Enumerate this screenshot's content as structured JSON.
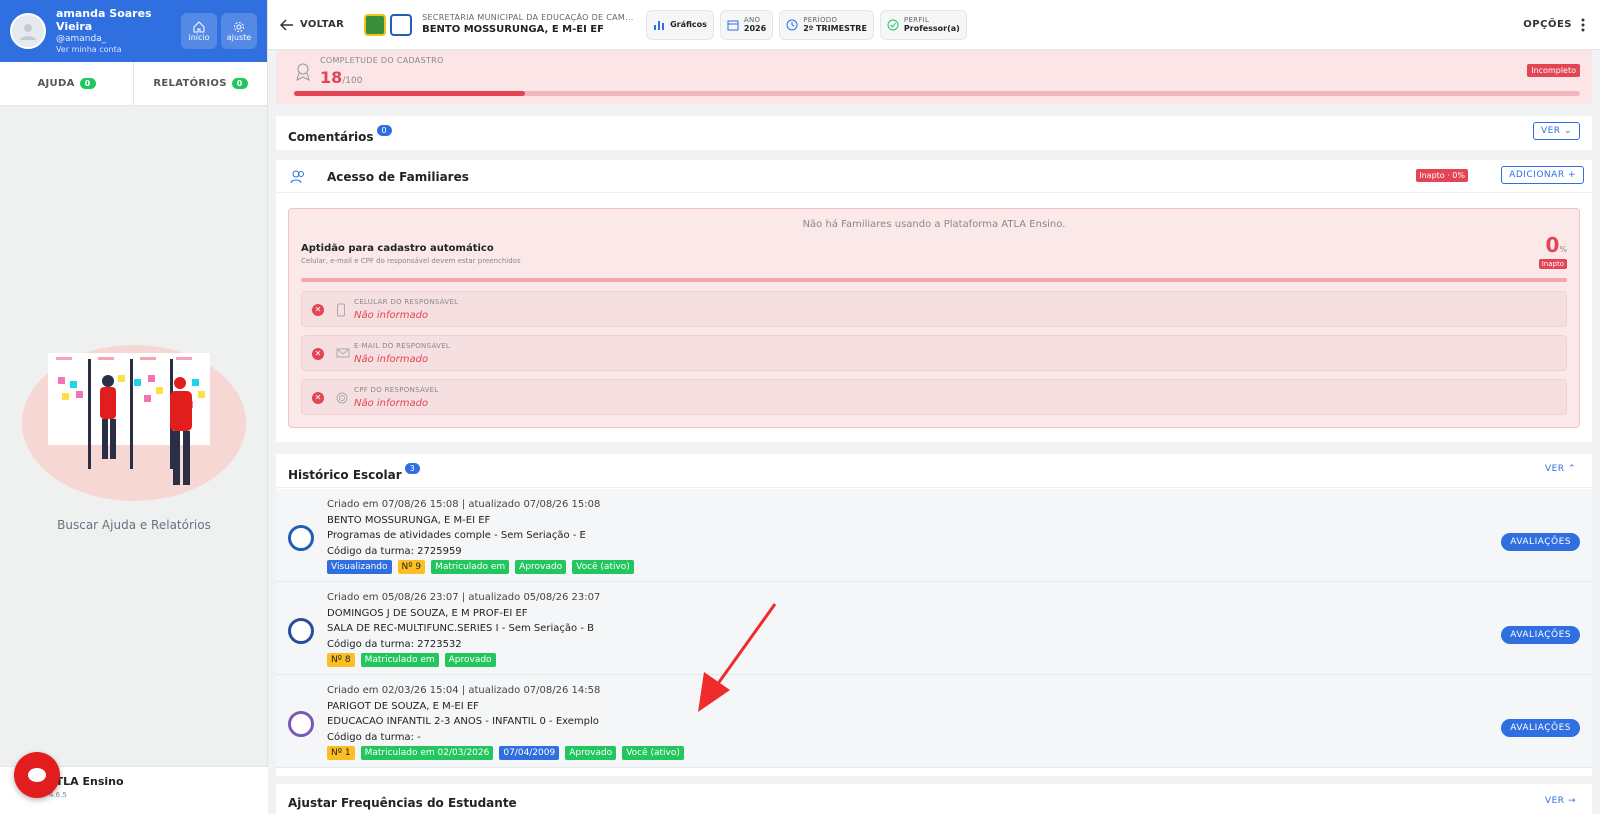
{
  "user": {
    "name": "amanda Soares Vieira",
    "handle": "@amanda_",
    "account_link": "Ver minha conta",
    "home_label": "início",
    "settings_label": "ajuste"
  },
  "help_tabs": [
    {
      "label": "AJUDA",
      "count": "0"
    },
    {
      "label": "RELATÓRIOS",
      "count": "0"
    }
  ],
  "help_caption": "Buscar Ajuda e Relatórios",
  "brand": {
    "name": "ATLA Ensino",
    "version": "4.6.5"
  },
  "topbar": {
    "back_label": "VOLTAR",
    "secretaria": "SECRETARIA MUNICIPAL DA EDUCAÇÃO DE CAM...",
    "school": "BENTO MOSSURUNGA, E M-EI EF",
    "graficos": "Gráficos",
    "ano_label": "ANO",
    "ano_value": "2026",
    "periodo_label": "PERÍODO",
    "periodo_value": "2º TRIMESTRE",
    "perfil_label": "PERFIL",
    "perfil_value": "Professor(a)",
    "options_label": "OPÇÕES"
  },
  "completeness": {
    "label": "COMPLETUDE DO CADASTRO",
    "value": "18",
    "max": "/100",
    "status": "Incompleto",
    "fraction": 0.18
  },
  "comments": {
    "title": "Comentários",
    "count": "0",
    "button": "VER"
  },
  "familiares": {
    "title": "Acesso de Familiares",
    "status": "Inapto · 0%",
    "add_button": "ADICIONAR",
    "empty": "Não há Familiares usando a Plataforma ATLA Ensino.",
    "aptidao_title": "Aptidão para cadastro automático",
    "aptidao_sub": "Celular, e-mail e CPF do responsável devem estar preenchidos",
    "pct": "0",
    "pct_unit": "%",
    "pct_badge": "Inapto",
    "requirements": [
      {
        "label": "CELULAR DO RESPONSÁVEL",
        "value": "Não informado",
        "icon": "phone-icon"
      },
      {
        "label": "E-MAIL DO RESPONSÁVEL",
        "value": "Não informado",
        "icon": "mail-icon"
      },
      {
        "label": "CPF DO RESPONSÁVEL",
        "value": "Não informado",
        "icon": "fingerprint-icon"
      }
    ]
  },
  "historico": {
    "title": "Histórico Escolar",
    "count": "3",
    "button": "VER",
    "eval_button": "AVALIAÇÕES",
    "rows": [
      {
        "meta": "Criado em 07/08/26 15:08 | atualizado 07/08/26 15:08",
        "school": "BENTO MOSSURUNGA, E M-EI EF",
        "program": "Programas de atividades comple - Sem Seriação - E",
        "code": "Código da turma: 2725959",
        "tags": [
          {
            "t": "Visualizando",
            "c": "blue"
          },
          {
            "t": "Nº 9",
            "c": "yel"
          },
          {
            "t": "Matriculado em",
            "c": "grn"
          },
          {
            "t": "Aprovado",
            "c": "grn"
          },
          {
            "t": "Você (ativo)",
            "c": "grn"
          }
        ]
      },
      {
        "meta": "Criado em 05/08/26 23:07 | atualizado 05/08/26 23:07",
        "school": "DOMINGOS J DE SOUZA, E M PROF-EI EF",
        "program": "SALA DE REC-MULTIFUNC.SERIES I - Sem Seriação - B",
        "code": "Código da turma: 2723532",
        "tags": [
          {
            "t": "Nº 8",
            "c": "yel"
          },
          {
            "t": "Matriculado em",
            "c": "grn"
          },
          {
            "t": "Aprovado",
            "c": "grn"
          }
        ]
      },
      {
        "meta": "Criado em 02/03/26 15:04 | atualizado 07/08/26 14:58",
        "school": "PARIGOT DE SOUZA, E M-EI EF",
        "program": "EDUCACAO INFANTIL 2-3 ANOS - INFANTIL 0 - Exemplo",
        "code": "Código da turma: -",
        "tags": [
          {
            "t": "Nº 1",
            "c": "yel"
          },
          {
            "t": "Matriculado em 02/03/2026",
            "c": "grn"
          },
          {
            "t": "07/04/2009",
            "c": "blue"
          },
          {
            "t": "Aprovado",
            "c": "grn"
          },
          {
            "t": "Você (ativo)",
            "c": "grn"
          }
        ]
      }
    ]
  },
  "frequencias": {
    "title": "Ajustar Frequências do Estudante",
    "button": "VER"
  },
  "colors": {
    "primary": "#2f6fe0",
    "danger": "#e34554",
    "success": "#22c55e",
    "warning": "#fbbf24"
  }
}
